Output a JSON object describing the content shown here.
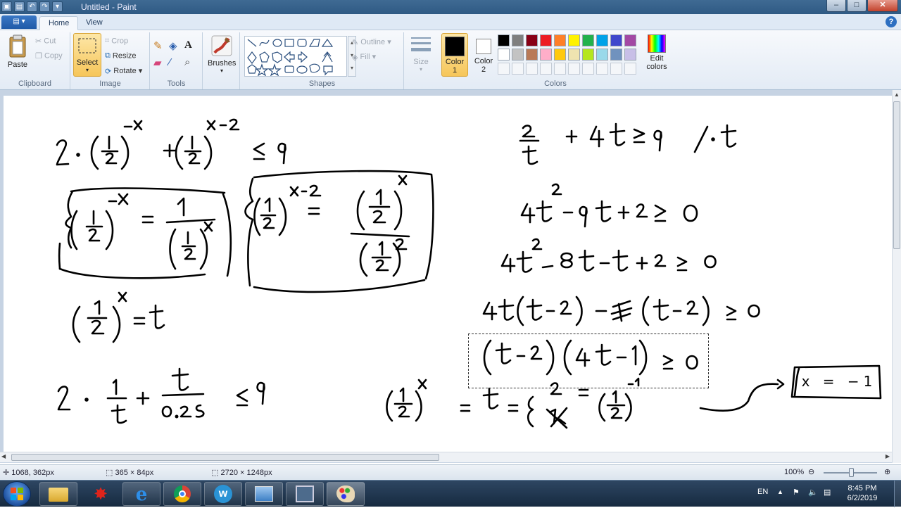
{
  "window": {
    "title": "Untitled - Paint"
  },
  "tabs": {
    "file": "",
    "home": "Home",
    "view": "View"
  },
  "ribbon": {
    "clipboard": {
      "label": "Clipboard",
      "paste": "Paste",
      "cut": "Cut",
      "copy": "Copy"
    },
    "image": {
      "label": "Image",
      "select": "Select",
      "crop": "Crop",
      "resize": "Resize",
      "rotate": "Rotate"
    },
    "tools": {
      "label": "Tools"
    },
    "brushes": {
      "label": "Brushes"
    },
    "shapes": {
      "label": "Shapes",
      "outline": "Outline",
      "fill": "Fill"
    },
    "size": {
      "label": "Size"
    },
    "colors": {
      "label": "Colors",
      "color1": "Color\n1",
      "color1_a": "Color",
      "color1_b": "1",
      "color2_a": "Color",
      "color2_b": "2",
      "edit_a": "Edit",
      "edit_b": "colors",
      "color1_value": "#000000",
      "color2_value": "#ffffff",
      "palette_row1": [
        "#000000",
        "#7f7f7f",
        "#880015",
        "#ed1c24",
        "#ff7f27",
        "#fff200",
        "#22b14c",
        "#00a2e8",
        "#3f48cc",
        "#a349a4"
      ],
      "palette_row2": [
        "#ffffff",
        "#c3c3c3",
        "#b97a57",
        "#ffaec9",
        "#ffc90e",
        "#efe4b0",
        "#b5e61d",
        "#99d9ea",
        "#7092be",
        "#c8bfe7"
      ]
    }
  },
  "status": {
    "cursor": "1068, 362px",
    "selection": "365 × 84px",
    "canvas_size": "2720 × 1248px",
    "zoom": "100%"
  },
  "taskbar": {
    "lang": "EN",
    "time": "8:45 PM",
    "date": "6/2/2019"
  },
  "canvas_text": {
    "boxed_answer": "x = −1"
  }
}
